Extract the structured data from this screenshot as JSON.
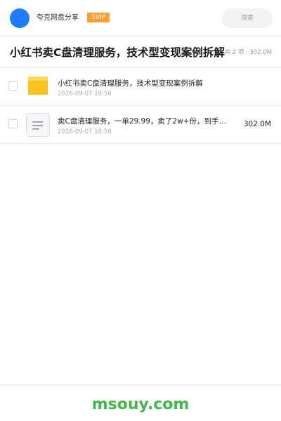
{
  "header": {
    "app_name": "夸克网盘分享",
    "badge": "SVIP",
    "search_placeholder": "搜索"
  },
  "title_bar": {
    "title": "小红书卖C盘清理服务，技术型变现案例拆解",
    "meta": "共 2 项 · 302.0M"
  },
  "files": [
    {
      "name": "小红书卖C盘清理服务，技术型变现案例拆解",
      "date": "2026-09-07 10:50",
      "size": "",
      "icon": "folder-icon"
    },
    {
      "name": "卖C盘清理服务，一单29.99，卖了2w+份，到手…",
      "date": "2026-09-07 10:50",
      "size": "302.0M",
      "icon": "document-icon"
    }
  ],
  "footer": {
    "watermark": "msouy.com"
  },
  "colors": {
    "accent_blue": "#1f7bff",
    "badge_orange": "#ff9d2e",
    "folder_yellow": "#ffc21c",
    "watermark_green": "#43b84a"
  }
}
